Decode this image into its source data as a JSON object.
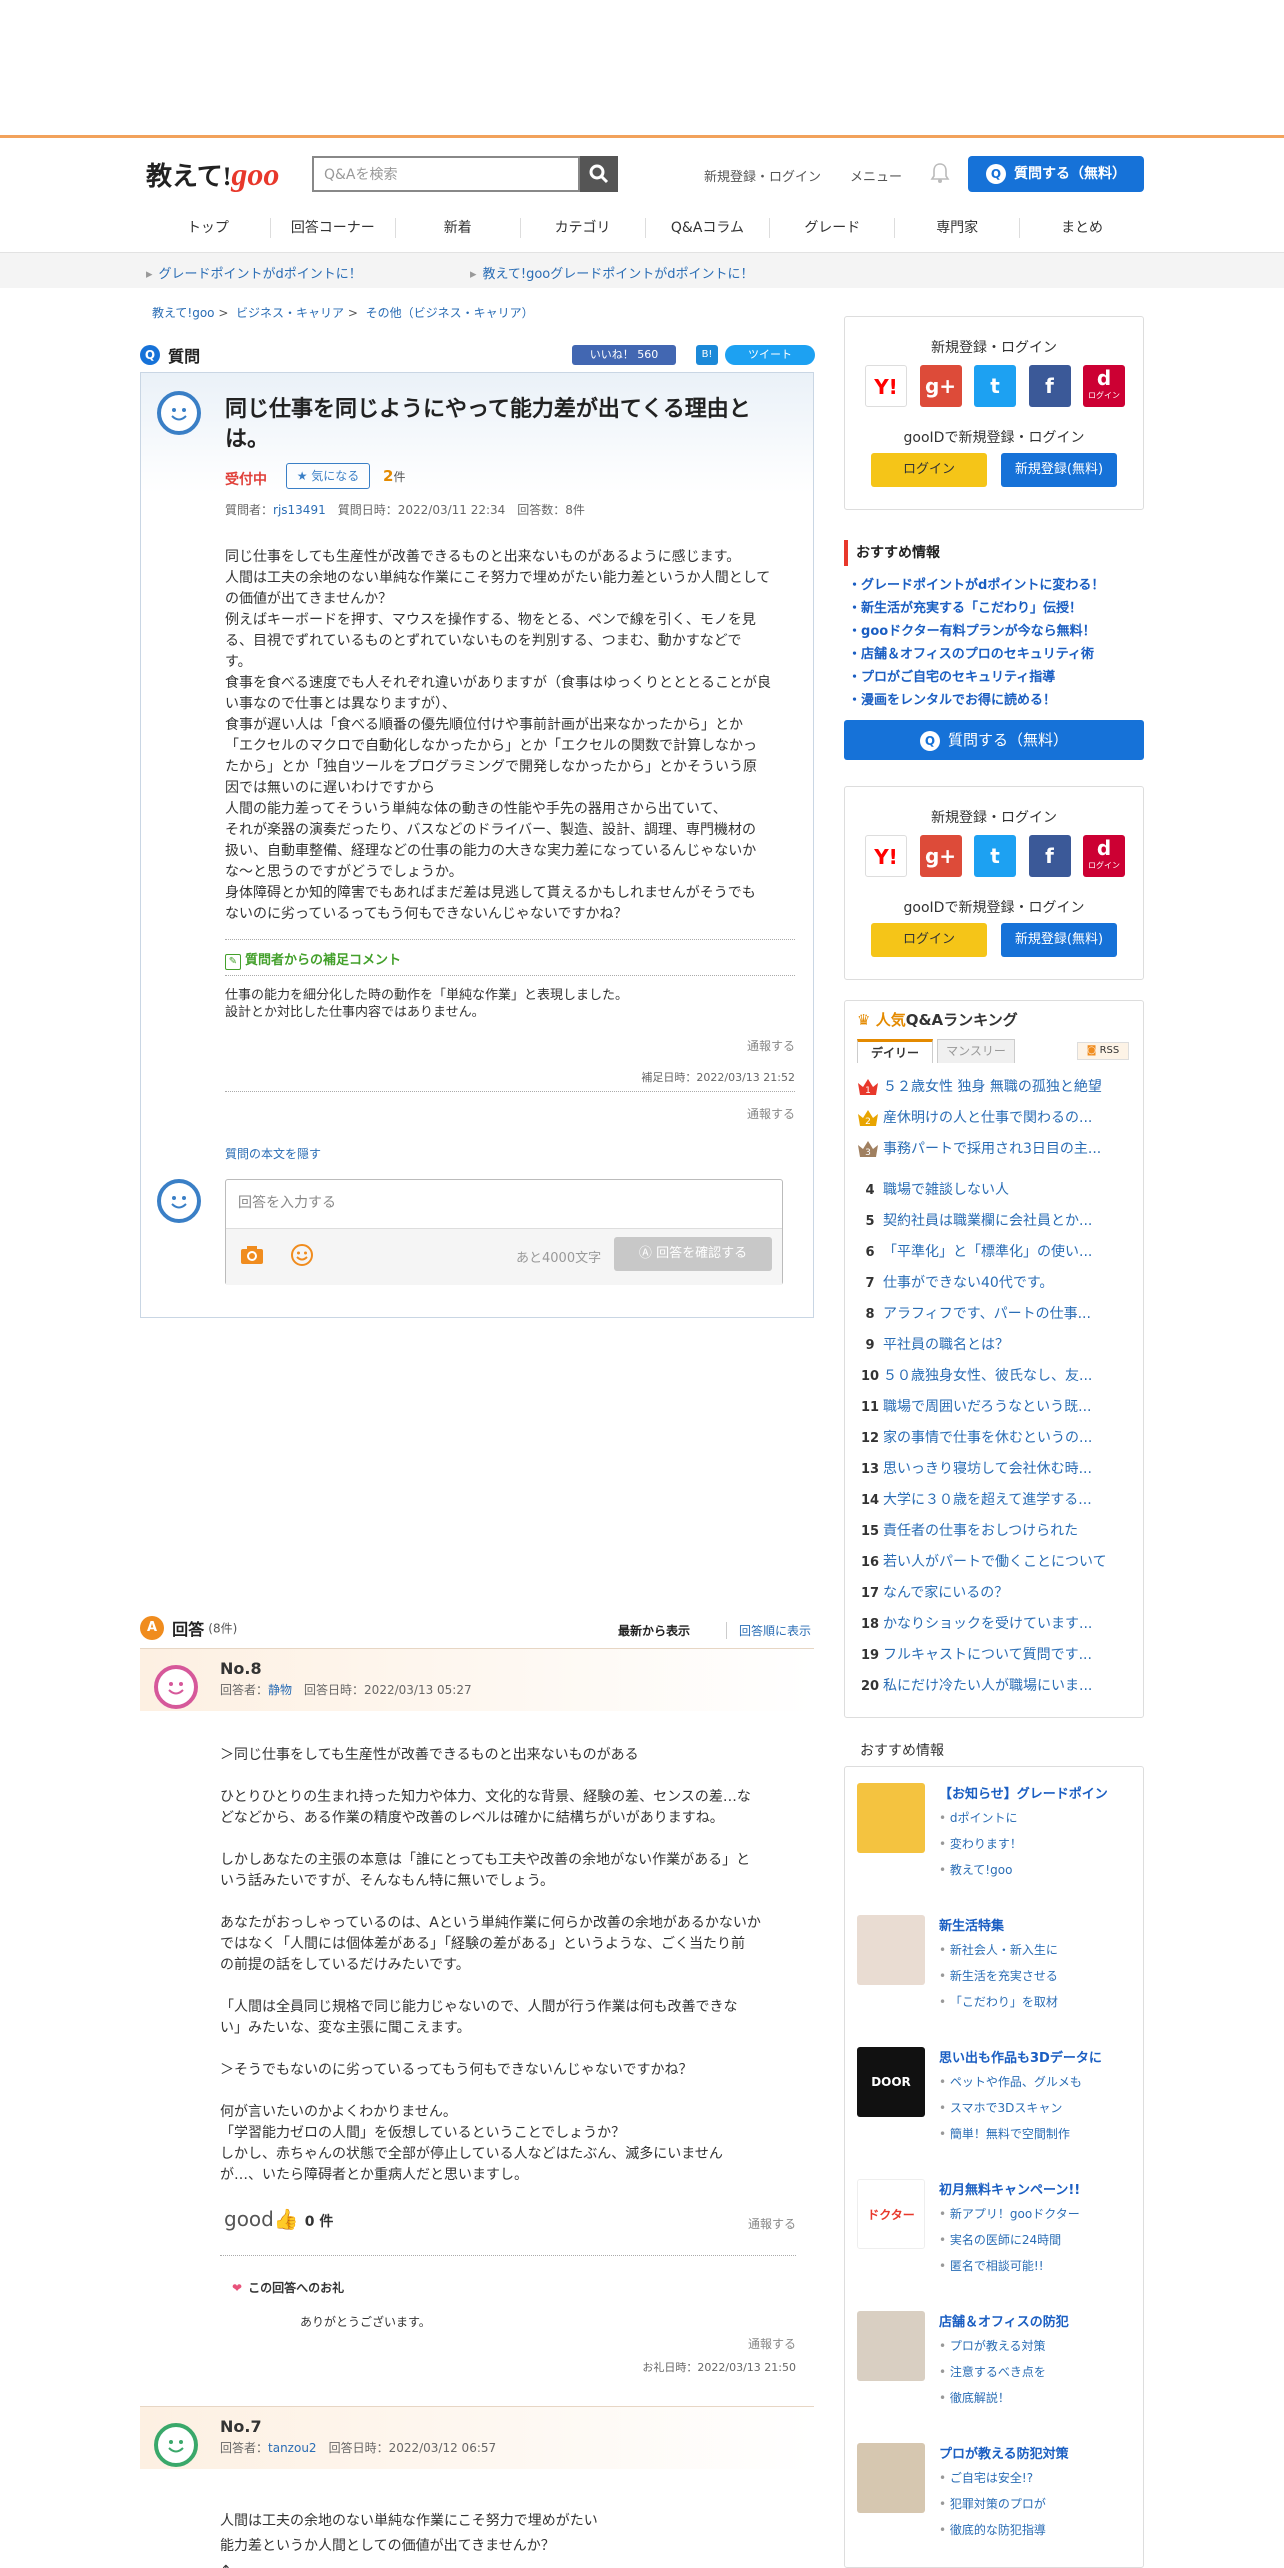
{
  "header": {
    "logo_text": "教えて!",
    "logo_goo": "goo",
    "search_placeholder": "Q&Aを検索",
    "register_login": "新規登録・ログイン",
    "menu": "メニュー",
    "ask_button": "質問する（無料）"
  },
  "nav": [
    "トップ",
    "回答コーナー",
    "新着",
    "カテゴリ",
    "Q&Aコラム",
    "グレード",
    "専門家",
    "まとめ"
  ],
  "notices": [
    "グレードポイントがdポイントに！",
    "教えて!gooグレードポイントがdポイントに！"
  ],
  "breadcrumb": {
    "home": "教えて!goo",
    "cat": "ビジネス・キャリア",
    "sub": "その他（ビジネス・キャリア）",
    "sep": ">"
  },
  "question": {
    "label": "質問",
    "badge": "Q",
    "like": "いいね！ 560",
    "tweet": "ツイート",
    "hb": "B!",
    "title": "同じ仕事を同じようにやって能力差が出てくる理由とは。",
    "status": "受付中",
    "fav": "気になる",
    "fav_count": "2",
    "fav_unit": "件",
    "meta_prefix": "質問者：",
    "asker": "rjs13491",
    "meta_rest": "質問日時：2022/03/11 22:34　回答数：8件",
    "body": [
      "同じ仕事をしても生産性が改善できるものと出来ないものがあるように感じます。",
      "人間は工夫の余地のない単純な作業にこそ努力で埋めがたい能力差というか人間として",
      "の価値が出てきませんか？",
      "例えばキーボードを押す、マウスを操作する、物をとる、ペンで線を引く、モノを見",
      "る、目視でずれているものとずれていないものを判別する、つまむ、動かすなどで",
      "す。",
      "食事を食べる速度でも人それぞれ違いがありますが（食事はゆっくりとととることが良",
      "い事なので仕事とは異なりますが）、",
      "食事が遅い人は「食べる順番の優先順位付けや事前計画が出来なかったから」とか",
      "「エクセルのマクロで自動化しなかったから」とか「エクセルの関数で計算しなかっ",
      "たから」とか「独自ツールをプログラミングで開発しなかったから」とかそういう原",
      "因では無いのに遅いわけですから",
      "人間の能力差ってそういう単純な体の動きの性能や手先の器用さから出ていて、",
      "それが楽器の演奏だったり、バスなどのドライバー、製造、設計、調理、専門機材の",
      "扱い、自動車整備、経理などの仕事の能力の大きな実力差になっているんじゃないか",
      "な～と思うのですがどうでしょうか。",
      "身体障碍とか知的障害でもあればまだ差は見逃して貰えるかもしれませんがそうでも",
      "ないのに劣っているってもう何もできないんじゃないですかね？"
    ],
    "supplement_title": "質問者からの補足コメント",
    "supplement_body": [
      "仕事の能力を細分化した時の動作を「単純な作業」と表現しました。",
      "設計とか対比した仕事内容ではありません。"
    ],
    "report": "通報する",
    "supplement_date": "補足日時：2022/03/13 21:52",
    "hide_link": "質問の本文を隠す",
    "answer_placeholder": "回答を入力する",
    "remaining": "あと4000文字",
    "confirm": "回答を確認する"
  },
  "answers_head": {
    "label": "回答",
    "badge": "A",
    "count": "(8件)",
    "sort_new": "最新から表示",
    "sort_old": "回答順に表示"
  },
  "answers": [
    {
      "no": "No.8",
      "meta_prefix": "回答者：",
      "name": "静物",
      "date": "回答日時：2022/03/13 05:27",
      "body": [
        "＞同じ仕事をしても生産性が改善できるものと出来ないものがある",
        "",
        "ひとりひとりの生まれ持った知力や体力、文化的な背景、経験の差、センスの差…な",
        "どなどから、ある作業の精度や改善のレベルは確かに結構ちがいがありますね。",
        "",
        "しかしあなたの主張の本意は「誰にとっても工夫や改善の余地がない作業がある」と",
        "いう話みたいですが、そんなもん特に無いでしょう。",
        "",
        "あなたがおっしゃっているのは、Aという単純作業に何らか改善の余地があるかないか",
        "ではなく「人間には個体差がある」「経験の差がある」というような、ごく当たり前",
        "の前提の話をしているだけみたいです。",
        "",
        "「人間は全員同じ規格で同じ能力じゃないので、人間が行う作業は何も改善できな",
        "い」みたいな、変な主張に聞こえます。",
        "",
        "＞そうでもないのに劣っているってもう何もできないんじゃないですかね？",
        "",
        "何が言いたいのかよくわかりません。",
        "「学習能力ゼロの人間」を仮想しているということでしょうか？",
        "しかし、赤ちゃんの状態で全部が停止している人などはたぶん、滅多にいません",
        "が…、いたら障碍者とか重病人だと思いますし。"
      ],
      "good": "good",
      "good_count": "0",
      "good_unit": "件",
      "report": "通報する",
      "thanks_title": "この回答へのお礼",
      "thanks_body": "ありがとうございます。",
      "thanks_report": "通報する",
      "thanks_date": "お礼日時：2022/03/13 21:50"
    },
    {
      "no": "No.7",
      "meta_prefix": "回答者：",
      "name": "tanzou2",
      "date": "回答日時：2022/03/12 06:57",
      "body": [
        "人間は工夫の余地のない単純な作業にこそ努力で埋めがたい",
        "能力差というか人間としての価値が出てきませんか？",
        "↑"
      ]
    }
  ],
  "sidebar": {
    "login_title": "新規登録・ログイン",
    "goo_id": "gooIDで新規登録・ログイン",
    "login": "ログイン",
    "register": "新規登録(無料)",
    "social": [
      {
        "label": "Y!",
        "color": "#ffffff"
      },
      {
        "label": "g+",
        "color": "#dd4b39"
      },
      {
        "label": "t",
        "color": "#1da1f2"
      },
      {
        "label": "f",
        "color": "#3b5998"
      },
      {
        "label": "d",
        "color": "#cc0033",
        "sub": "ログイン"
      }
    ],
    "rec_title": "おすすめ情報",
    "rec": [
      "グレードポイントがdポイントに変わる！",
      "新生活が充実する「こだわり」伝授！",
      "gooドクター有料プランが今なら無料！",
      "店舗＆オフィスのプロのセキュリティ術",
      "プロがご自宅のセキュリティ指導",
      "漫画をレンタルでお得に読める！"
    ],
    "ask": "質問する（無料）",
    "rank_title_a": "人気",
    "rank_title_b": "Q&Aランキング",
    "tab_daily": "デイリー",
    "tab_monthly": "マンスリー",
    "rss": "RSS",
    "ranking": [
      "５２歳女性 独身 無職の孤独と絶望",
      "産休明けの人と仕事で関わるの...",
      "事務パートで採用され3日目の主...",
      "職場で雑談しない人",
      "契約社員は職業欄に会社員とか...",
      "「平準化」と「標準化」の使い...",
      "仕事ができない40代です。",
      "アラフィフです、パートの仕事...",
      "平社員の職名とは？",
      "５０歳独身女性、彼氏なし、友...",
      "職場で周囲いだろうなという既...",
      "家の事情で仕事を休むというの...",
      "思いっきり寝坊して会社休む時...",
      "大学に３０歳を超えて進学する...",
      "責任者の仕事をおしつけられた",
      "若い人がパートで働くことについて",
      "なんで家にいるの？",
      "かなりショックを受けています...",
      "フルキャストについて質問です...",
      "私にだけ冷たい人が職場にいま..."
    ],
    "osusume": "おすすめ情報",
    "features": [
      {
        "title": "【お知らせ】グレードポイン",
        "subs": [
          "dポイントに",
          "変わります！",
          "教えて!goo"
        ],
        "img": "#f4c340"
      },
      {
        "title": "新生活特集",
        "subs": [
          "新社会人・新入生に",
          "新生活を充実させる",
          "「こだわり」を取材"
        ],
        "img": "#e9dcd2"
      },
      {
        "title": "思い出も作品も3Dデータに",
        "subs": [
          "ペットや作品、グルメも",
          "スマホで3Dスキャン",
          "簡単！無料で空間制作"
        ],
        "img": "#111111",
        "logo": "DOOR"
      },
      {
        "title": "初月無料キャンペーン!!",
        "subs": [
          "新アプリ！gooドクター",
          "実名の医師に24時間",
          "匿名で相談可能!!"
        ],
        "img": "#ffffff",
        "logo": "ドクター"
      },
      {
        "title": "店舗＆オフィスの防犯",
        "subs": [
          "プロが教える対策",
          "注意するべき点を",
          "徹底解説！"
        ],
        "img": "#d9cfc2"
      },
      {
        "title": "プロが教える防犯対策",
        "subs": [
          "ご自宅は安全!?",
          "犯罪対策のプロが",
          "徹底的な防犯指導"
        ],
        "img": "#d6c7b0"
      }
    ]
  }
}
